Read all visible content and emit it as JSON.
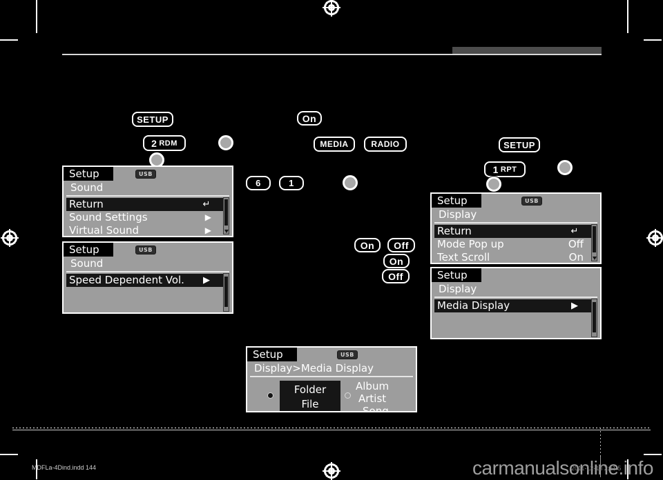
{
  "page": {
    "background_color": "#000000",
    "footer_file": "MDFLa-4Dind.indd   144",
    "watermark": "carmanualsonline.info",
    "timestamp": "2011-12-13   2:11:5"
  },
  "callouts": {
    "setup_left": "SETUP",
    "setup_right": "SETUP",
    "rdm": {
      "num": "2",
      "sub": "RDM"
    },
    "rpt": {
      "num": "1",
      "sub": "RPT"
    },
    "on_top": "On",
    "media": "MEDIA",
    "radio": "RADIO",
    "six": "6",
    "one": "1",
    "on_a": "On",
    "off_a": "Off",
    "on_b": "On",
    "off_b": "Off"
  },
  "panels": {
    "sound_main": {
      "tab": "Setup",
      "badge": "USB",
      "subtitle": "Sound",
      "rows": [
        {
          "label": "Return",
          "value": "",
          "selected": true,
          "control": "return-arrow"
        },
        {
          "label": "Sound Settings",
          "value": "",
          "selected": false,
          "control": "submenu-arrow"
        },
        {
          "label": "Virtual Sound",
          "value": "",
          "selected": false,
          "control": "submenu-arrow"
        }
      ]
    },
    "sound_speed": {
      "tab": "Setup",
      "badge": "USB",
      "subtitle": "Sound",
      "rows": [
        {
          "label": "Speed Dependent Vol.",
          "value": "",
          "selected": true,
          "control": "submenu-box-arrow"
        }
      ]
    },
    "display_main": {
      "tab": "Setup",
      "badge": "USB",
      "subtitle": "Display",
      "rows": [
        {
          "label": "Return",
          "value": "",
          "selected": true,
          "control": "return-arrow"
        },
        {
          "label": "Mode Pop up",
          "value": "Off",
          "selected": false,
          "control": "value"
        },
        {
          "label": "Text Scroll",
          "value": "On",
          "selected": false,
          "control": "value"
        }
      ]
    },
    "display_media": {
      "tab": "Setup",
      "badge": "",
      "subtitle": "Display",
      "rows": [
        {
          "label": "Media Display",
          "value": "",
          "selected": true,
          "control": "submenu-box-arrow"
        }
      ]
    },
    "media_display": {
      "tab": "Setup",
      "badge": "USB",
      "subtitle": "Display>Media Display",
      "option_left": {
        "line1": "Folder",
        "line2": "File",
        "selected": true
      },
      "option_right": {
        "line1": "Album",
        "line2": "Artist",
        "line3": "Song",
        "selected": false
      }
    }
  }
}
